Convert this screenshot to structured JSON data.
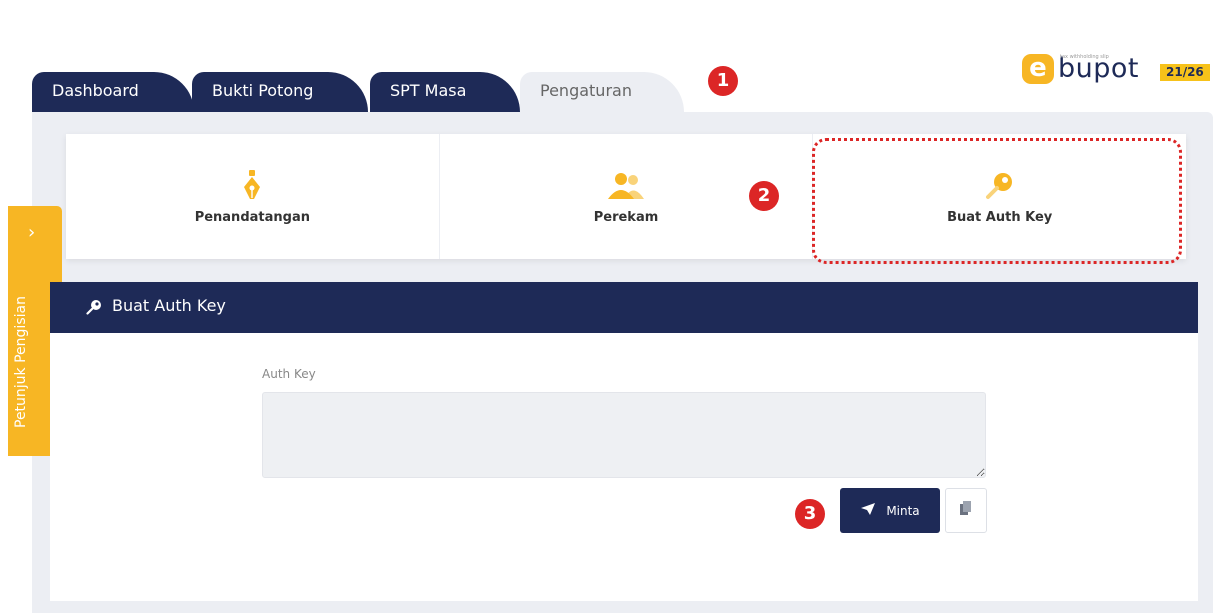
{
  "brand": {
    "letter": "e",
    "tagline": "tax withholding slip",
    "name": "bupot",
    "page_indicator": "21/26"
  },
  "tabs": [
    {
      "label": "Dashboard",
      "active": false
    },
    {
      "label": "Bukti Potong",
      "active": false
    },
    {
      "label": "SPT Masa",
      "active": false
    },
    {
      "label": "Pengaturan",
      "active": true
    }
  ],
  "markers": [
    "1",
    "2",
    "3"
  ],
  "side_panel": {
    "label": "Petunjuk Pengisian",
    "chevron": "›"
  },
  "cards": [
    {
      "label": "Penandatangan",
      "icon": "pen-nib-icon"
    },
    {
      "label": "Perekam",
      "icon": "users-icon"
    },
    {
      "label": "Buat Auth Key",
      "icon": "key-icon",
      "highlighted": true
    }
  ],
  "section": {
    "title": "Buat Auth Key",
    "icon": "key-icon"
  },
  "form": {
    "label": "Auth Key",
    "value": "",
    "placeholder": ""
  },
  "buttons": {
    "request_label": "Minta",
    "copy_icon": "copy-icon"
  },
  "colors": {
    "navy": "#1e2a57",
    "accent": "#f7b624",
    "annotation": "#dc2626",
    "panel_bg": "#eceef3"
  }
}
